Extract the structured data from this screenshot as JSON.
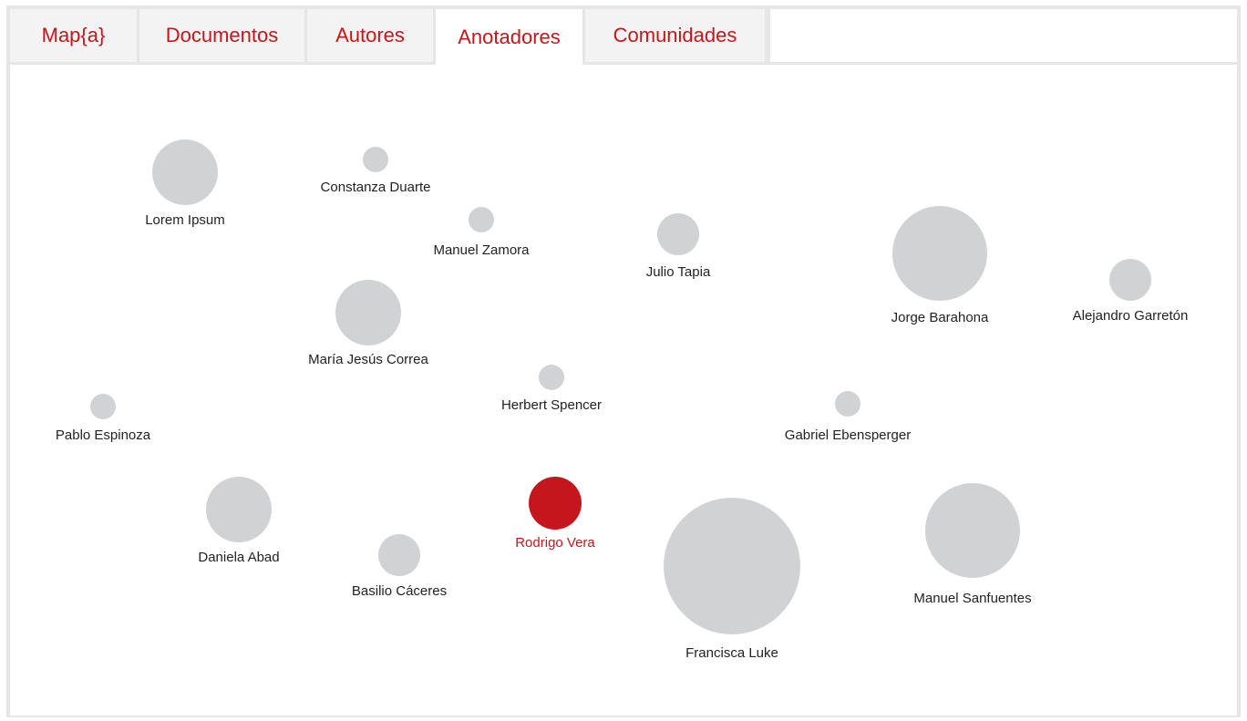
{
  "tabs": [
    {
      "label": "Map{a}",
      "active": false
    },
    {
      "label": "Documentos",
      "active": false
    },
    {
      "label": "Autores",
      "active": false
    },
    {
      "label": "Anotadores",
      "active": true
    },
    {
      "label": "Comunidades",
      "active": false
    }
  ],
  "colors": {
    "accent": "#c4161c",
    "node": "#d1d2d4",
    "label": "#222222",
    "border": "#e6e6e6",
    "tab_bg": "#f3f3f3"
  },
  "annotators": [
    {
      "name": "Lorem Ipsum",
      "selected": false
    },
    {
      "name": "Constanza Duarte",
      "selected": false
    },
    {
      "name": "Manuel Zamora",
      "selected": false
    },
    {
      "name": "Julio Tapia",
      "selected": false
    },
    {
      "name": "Jorge Barahona",
      "selected": false
    },
    {
      "name": "Alejandro Garretón",
      "selected": false
    },
    {
      "name": "María Jesús Correa",
      "selected": false
    },
    {
      "name": "Herbert Spencer",
      "selected": false
    },
    {
      "name": "Pablo Espinoza",
      "selected": false
    },
    {
      "name": "Gabriel Ebensperger",
      "selected": false
    },
    {
      "name": "Daniela Abad",
      "selected": false
    },
    {
      "name": "Rodrigo Vera",
      "selected": true
    },
    {
      "name": "Basilio Cáceres",
      "selected": false
    },
    {
      "name": "Francisca Luke",
      "selected": false
    },
    {
      "name": "Manuel Sanfuentes",
      "selected": false
    }
  ]
}
